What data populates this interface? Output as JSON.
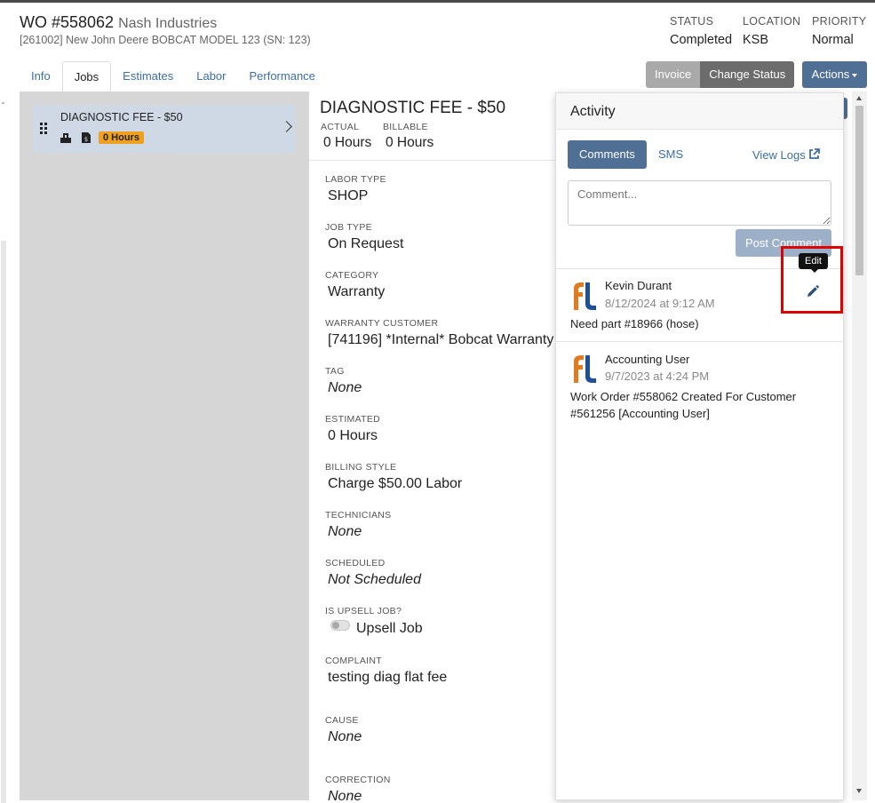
{
  "header": {
    "wo_number": "WO #558062",
    "customer": "Nash Industries",
    "equipment": "[261002] New John Deere BOBCAT MODEL 123 (SN: 123)",
    "status_label": "STATUS",
    "status_value": "Completed",
    "location_label": "LOCATION",
    "location_value": "KSB",
    "priority_label": "PRIORITY",
    "priority_value": "Normal"
  },
  "tabs": [
    "Info",
    "Jobs",
    "Estimates",
    "Labor",
    "Performance"
  ],
  "active_tab": "Jobs",
  "toolbar": {
    "invoice": "Invoice",
    "change_status": "Change Status",
    "actions": "Actions"
  },
  "job_list": [
    {
      "name": "DIAGNOSTIC FEE - $50",
      "hours_badge": "0 Hours",
      "badge_color": "#f0a020",
      "icons": [
        "user-group-icon",
        "invoice-dollar-icon"
      ]
    }
  ],
  "job_detail": {
    "title": "DIAGNOSTIC FEE - $50",
    "actual_label": "ACTUAL",
    "actual_value": "0 Hours",
    "billable_label": "BILLABLE",
    "billable_value": "0 Hours",
    "fields": [
      {
        "label": "LABOR TYPE",
        "value": "SHOP"
      },
      {
        "label": "JOB TYPE",
        "value": "On Request"
      },
      {
        "label": "CATEGORY",
        "value": "Warranty"
      },
      {
        "label": "WARRANTY CUSTOMER",
        "value": "[741196] *Internal* Bobcat Warranty"
      },
      {
        "label": "TAG",
        "value": "None"
      },
      {
        "label": "ESTIMATED",
        "value": "0 Hours"
      },
      {
        "label": "BILLING STYLE",
        "value": "Charge $50.00 Labor"
      },
      {
        "label": "TECHNICIANS",
        "value": "None"
      },
      {
        "label": "SCHEDULED",
        "value": "Not Scheduled"
      },
      {
        "label": "IS UPSELL JOB?",
        "value": "Upsell Job"
      },
      {
        "label": "COMPLAINT",
        "value": "testing diag flat fee"
      },
      {
        "label": "CAUSE",
        "value": "None"
      },
      {
        "label": "CORRECTION",
        "value": "None"
      }
    ]
  },
  "activity": {
    "title": "Activity",
    "tabs": [
      "Comments",
      "SMS"
    ],
    "active_tab": "Comments",
    "view_logs": "View Logs",
    "comment_placeholder": "Comment...",
    "post_button": "Post Comment",
    "edit_tooltip": "Edit",
    "entries": [
      {
        "author": "Kevin Durant",
        "timestamp": "8/12/2024 at 9:12 AM",
        "body": "Need part #18966 (hose)"
      },
      {
        "author": "Accounting User",
        "timestamp": "9/7/2023 at 4:24 PM",
        "body": "Work Order #558062 Created For Customer #561256 [Accounting User]"
      }
    ]
  },
  "colors": {
    "accent": "#4f6f94",
    "link": "#3b6ea5",
    "badge_orange": "#f0a020",
    "logo_orange": "#e07b22",
    "logo_blue": "#1f4f99",
    "highlight_red": "#e00000"
  }
}
